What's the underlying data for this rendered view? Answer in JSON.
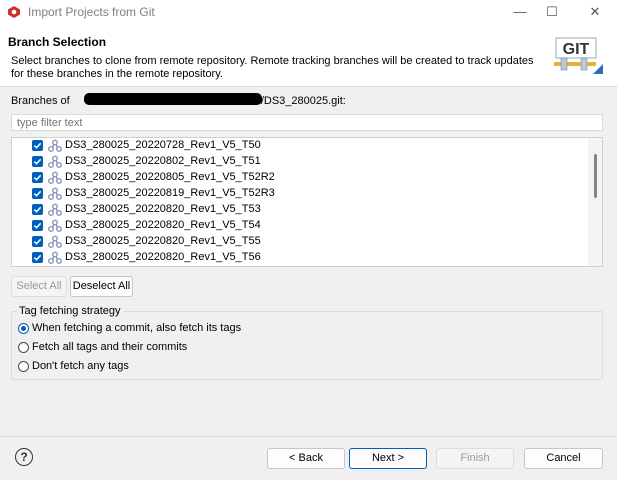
{
  "window": {
    "title": "Import Projects from Git",
    "minimize_glyph": "—",
    "maximize_glyph": "☐",
    "close_glyph": "✕"
  },
  "header": {
    "title": "Branch Selection",
    "description": "Select branches to clone from remote repository. Remote tracking branches will be created to track updates for these branches in the remote repository.",
    "logo_text": "GIT"
  },
  "branches": {
    "label_prefix": "Branches of",
    "label_suffix": "/DS3_280025.git:",
    "filter_placeholder": "type filter text",
    "items": [
      {
        "name": "DS3_280025_20220728_Rev1_V5_T50",
        "checked": true
      },
      {
        "name": "DS3_280025_20220802_Rev1_V5_T51",
        "checked": true
      },
      {
        "name": "DS3_280025_20220805_Rev1_V5_T52R2",
        "checked": true
      },
      {
        "name": "DS3_280025_20220819_Rev1_V5_T52R3",
        "checked": true
      },
      {
        "name": "DS3_280025_20220820_Rev1_V5_T53",
        "checked": true
      },
      {
        "name": "DS3_280025_20220820_Rev1_V5_T54",
        "checked": true
      },
      {
        "name": "DS3_280025_20220820_Rev1_V5_T55",
        "checked": true
      },
      {
        "name": "DS3_280025_20220820_Rev1_V5_T56",
        "checked": true
      }
    ],
    "select_all": "Select All",
    "deselect_all": "Deselect All"
  },
  "tag_fetching": {
    "label": "Tag fetching strategy",
    "options": [
      {
        "label": "When fetching a commit, also fetch its tags",
        "selected": true
      },
      {
        "label": "Fetch all tags and their commits",
        "selected": false
      },
      {
        "label": "Don't fetch any tags",
        "selected": false
      }
    ]
  },
  "footer": {
    "help_glyph": "?",
    "back": "< Back",
    "next": "Next >",
    "finish": "Finish",
    "cancel": "Cancel"
  },
  "colors": {
    "accent": "#005fb8",
    "background": "#f0f0f0"
  }
}
